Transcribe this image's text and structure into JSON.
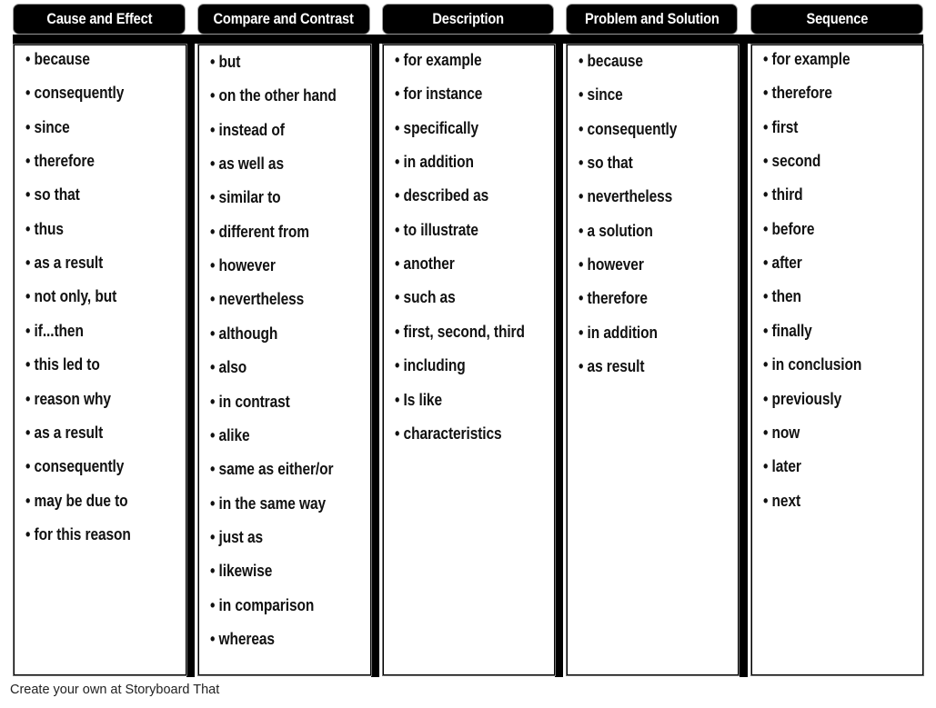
{
  "columns": [
    {
      "title": "Cause and Effect",
      "items": [
        "because",
        "consequently",
        "since",
        "therefore",
        "so that",
        "thus",
        "as a result",
        "not only, but",
        "if...then",
        "this led to",
        "reason why",
        "as a result",
        "consequently",
        "may be due to",
        "for this reason"
      ]
    },
    {
      "title": "Compare and Contrast",
      "items": [
        "but",
        "on the other hand",
        "instead of",
        "as well as",
        "similar to",
        "different from",
        "however",
        "nevertheless",
        "although",
        "also",
        "in contrast",
        "alike",
        "same as either/or",
        "in the same way",
        "just as",
        "likewise",
        "in comparison",
        "whereas"
      ]
    },
    {
      "title": "Description",
      "items": [
        "for example",
        "for instance",
        "specifically",
        "in addition",
        "described as",
        "to illustrate",
        "another",
        "such as",
        "first, second, third",
        "including",
        "Is like",
        "characteristics"
      ]
    },
    {
      "title": "Problem and Solution",
      "items": [
        "because",
        "since",
        "consequently",
        "so that",
        "nevertheless",
        "a solution",
        "however",
        "therefore",
        "in addition",
        "as result"
      ]
    },
    {
      "title": "Sequence",
      "items": [
        "for example",
        "therefore",
        "first",
        "second",
        "third",
        "before",
        "after",
        "then",
        "finally",
        "in conclusion",
        "previously",
        "now",
        "later",
        "next"
      ]
    }
  ],
  "bullet": "•",
  "footer": "Create your own at Storyboard That"
}
